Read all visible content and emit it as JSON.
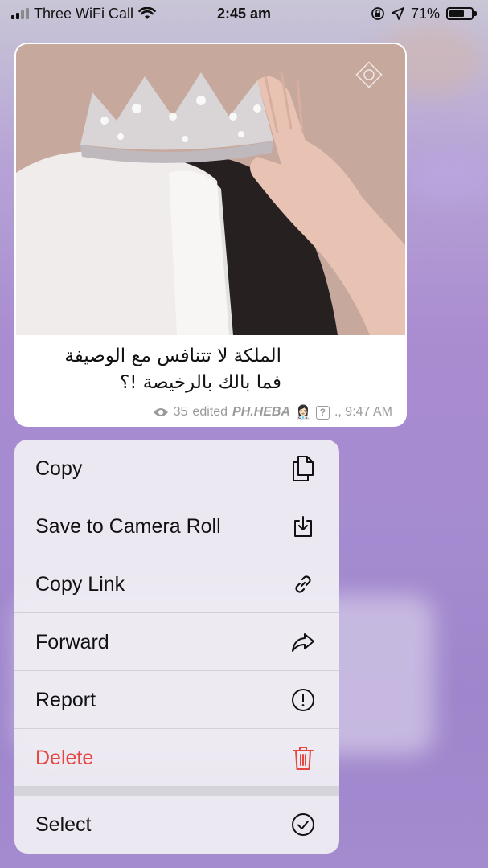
{
  "status_bar": {
    "carrier": "Three WiFi Call",
    "time": "2:45 am",
    "battery": "71%",
    "battery_level": 0.71
  },
  "message": {
    "caption_line1": "الملكة لا تتنافس مع الوصيفة",
    "caption_line2": "فما بالك بالرخيصة !؟",
    "views": "35",
    "edited": "edited",
    "author": "PH.HEBA",
    "author_emoji": "👩🏻‍⚕️",
    "time": "., 9:47 AM"
  },
  "menu": {
    "items": [
      {
        "label": "Copy",
        "icon": "copy-icon"
      },
      {
        "label": "Save to Camera Roll",
        "icon": "download-icon"
      },
      {
        "label": "Copy Link",
        "icon": "link-icon"
      },
      {
        "label": "Forward",
        "icon": "forward-icon"
      },
      {
        "label": "Report",
        "icon": "exclamation-circle-icon"
      },
      {
        "label": "Delete",
        "icon": "trash-icon",
        "color": "#e5473e"
      },
      {
        "label": "Select",
        "icon": "check-circle-icon"
      }
    ]
  },
  "colors": {
    "danger": "#e5473e",
    "background_purple": "#a98bd0"
  }
}
